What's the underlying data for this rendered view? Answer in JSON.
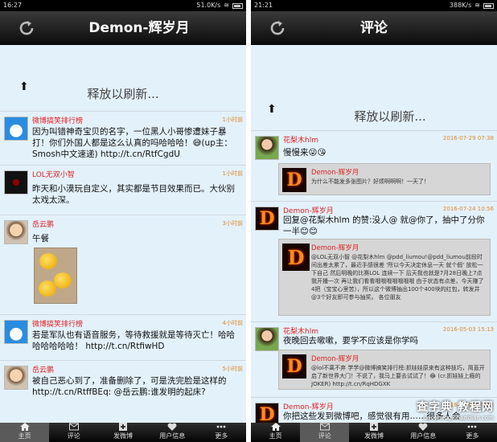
{
  "left": {
    "status": {
      "time": "16:27",
      "speed": "51.0K/s"
    },
    "title": "Demon-辉岁月",
    "pull_text": "释放以刷新...",
    "items": [
      {
        "name": "微博搞笑排行榜",
        "time": "1小时前",
        "text": "因为叫错神奇宝贝的名字，一位黑人小哥惨遭妹子暴打！你们外国人都是这么认真的吗哈哈哈！😅(up主：Smosh中文速递) http://t.cn/RtfCgdU"
      },
      {
        "name": "LOL无双小智",
        "time": "1小时前",
        "text": "昨天和小漠玩自定义，其实都是节目效果而已。大伙别太戏太深。"
      },
      {
        "name": "岳云鹏",
        "time": "3小时前",
        "text": "午餐"
      },
      {
        "name": "微博搞笑排行榜",
        "time": "4小时前",
        "text": "若是军队也有语音服务，等待救援就是等待灭亡！哈哈哈哈哈哈哈！ http://t.cn/RtfiwHD"
      },
      {
        "name": "岳云鹏",
        "time": "5小时前",
        "text": "被自己恶心到了，准备删除了，可是洗完脸是这样的 http://t.cn/RtffBEq: @岳云鹏:谁发明的起床?"
      }
    ],
    "tabs": [
      "主页",
      "评论",
      "发微博",
      "用户信息",
      "更多"
    ]
  },
  "right": {
    "status": {
      "time": "21:21",
      "speed": "388K/s"
    },
    "title": "评论",
    "pull_text": "释放以刷新...",
    "items": [
      {
        "name": "花梨木hlm",
        "time": "2016-07-29 07:38",
        "text": "慢慢来😜😘",
        "quote": {
          "name": "Demon-辉岁月",
          "text": "为什么不能发多张图片？好烦啊啊啊！一天了！"
        }
      },
      {
        "name": "Demon-辉岁月",
        "time": "2016-07-24 10:56",
        "text": "回复@花梨木hlm 的赞:没人@ 就@你了，抽中了分你一半😊😊",
        "quote": {
          "name": "Demon-辉岁月",
          "text": "@LOL无双小智 @花梨木hlm @pdd_liumou!@pdd_liumou前段时间出差太累了，最近手感很差 '所以今天决定休息一天 就个假' 放松一下自己 然后明晚的比赛LOL 连续一下 后天我也就是7月28日晚上7点我开播一次 再让我们看看哦哦哦哦哦哦哦 由于状态有点差，今天赚了4把（宝宝心里苦），所以这个微博抽出100个400块的红包，转发并@3个好友即可参与抽奖。 各位朋友"
        }
      },
      {
        "name": "花梨木hlm",
        "time": "2016-05-03 15:13",
        "text": "夜晚回去嗽嗽，要学不应该是你学吗",
        "quote": {
          "name": "Demon-辉岁月",
          "text": "@lol不离不弃 学学@微博搞笑排行榜:抓娃娃原来有这种技巧，简直开启了新世界大门！不说了，我马上要去试试了！😂 (cr.抓娃娃上瘾的JOKER) http://t.cn/RqHDGXK"
        }
      },
      {
        "name": "Demon-辉岁月",
        "time": "2016-05-03 15:12",
        "text": "你把这些发到微博吧，感觉很有用……很多人会"
      }
    ],
    "tabs": [
      "主页",
      "评论",
      "发微博",
      "用户信息",
      "更多"
    ],
    "watermark": {
      "main": "查字典 教程网",
      "sub": "jiaocheng.chazidian.com"
    }
  }
}
